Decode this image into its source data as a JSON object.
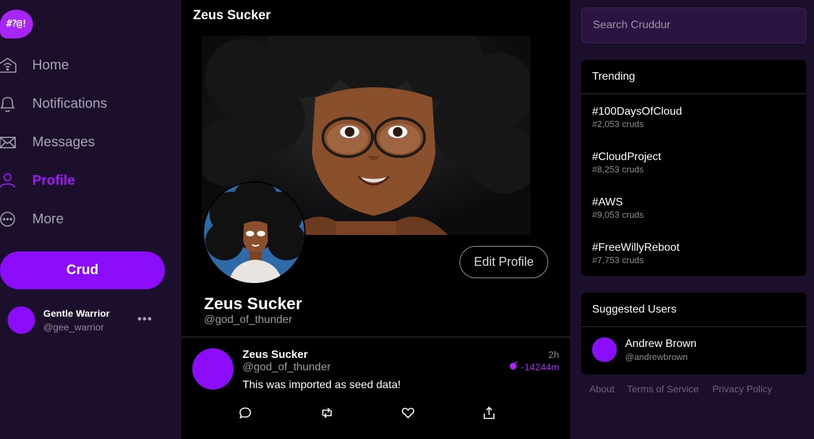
{
  "logo": {
    "text": "#?@!"
  },
  "nav": {
    "items": [
      {
        "label": "Home",
        "icon": "home-icon"
      },
      {
        "label": "Notifications",
        "icon": "bell-icon"
      },
      {
        "label": "Messages",
        "icon": "mail-icon"
      },
      {
        "label": "Profile",
        "icon": "user-icon",
        "active": true
      },
      {
        "label": "More",
        "icon": "more-circle-icon"
      }
    ],
    "crud_button": "Crud",
    "current_user": {
      "name": "Gentle Warrior",
      "handle": "@gee_warrior",
      "menu": "•••"
    }
  },
  "main": {
    "title": "Zeus Sucker",
    "profile": {
      "display_name": "Zeus Sucker",
      "handle": "@god_of_thunder",
      "edit_button": "Edit Profile"
    },
    "posts": [
      {
        "display_name": "Zeus Sucker",
        "handle": "@god_of_thunder",
        "message": "This was imported as seed data!",
        "created": "2h",
        "expires": "-14244m"
      }
    ]
  },
  "search": {
    "placeholder": "Search Cruddur"
  },
  "trending": {
    "title": "Trending",
    "items": [
      {
        "tag": "#100DaysOfCloud",
        "count": "#2,053 cruds"
      },
      {
        "tag": "#CloudProject",
        "count": "#8,253 cruds"
      },
      {
        "tag": "#AWS",
        "count": "#9,053 cruds"
      },
      {
        "tag": "#FreeWillyReboot",
        "count": "#7,753 cruds"
      }
    ]
  },
  "suggested": {
    "title": "Suggested Users",
    "users": [
      {
        "name": "Andrew Brown",
        "handle": "@andrewbrown"
      }
    ]
  },
  "footer": {
    "about": "About",
    "terms": "Terms of Service",
    "privacy": "Privacy Policy"
  },
  "colors": {
    "accent": "#8b0dfc",
    "sidebar_bg": "#1c0f2b",
    "main_bg": "#000000"
  }
}
